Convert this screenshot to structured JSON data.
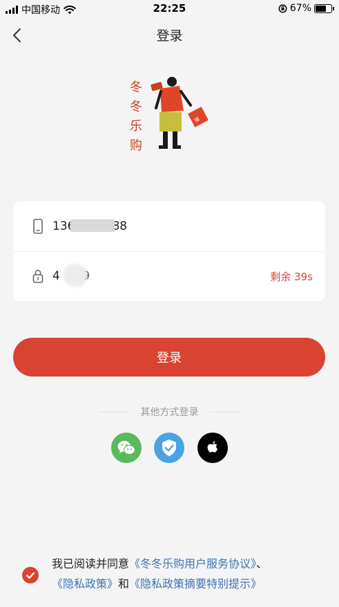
{
  "status_bar": {
    "carrier": "中国移动",
    "time": "22:25",
    "battery": "67%",
    "battery_level": 0.67
  },
  "nav": {
    "back_icon": "chevron-left-icon",
    "title": "登录"
  },
  "logo": {
    "chars": [
      "冬",
      "冬",
      "乐",
      "购"
    ],
    "bag_text": "福"
  },
  "form": {
    "phone_value": "136        888",
    "code_value": "4      9",
    "countdown": "剩余 39s",
    "phone_icon": "phone-icon",
    "lock_icon": "lock-icon"
  },
  "login_button": "登录",
  "other_login": {
    "label": "其他方式登录",
    "options": [
      "wechat-icon",
      "shield-icon",
      "apple-icon"
    ]
  },
  "agreement": {
    "prefix": "我已阅读并同意",
    "link_user": "《冬冬乐购用户服务协议》",
    "sep": "、",
    "link_privacy": "《隐私政策》",
    "and": "和",
    "link_summary": "《隐私政策摘要特别提示》"
  },
  "colors": {
    "accent": "#d94332",
    "link": "#3f72b5",
    "wechat": "#5cb85c",
    "shield": "#4aa3e3",
    "apple": "#000000"
  }
}
